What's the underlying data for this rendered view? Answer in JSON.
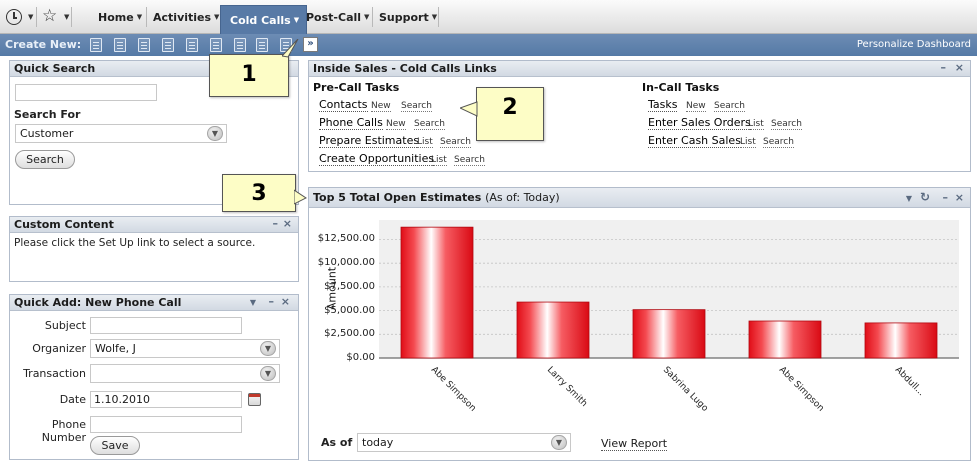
{
  "nav": {
    "items": [
      {
        "label": "Home"
      },
      {
        "label": "Activities"
      },
      {
        "label": "Cold Calls"
      },
      {
        "label": "Post-Call"
      },
      {
        "label": "Support"
      }
    ]
  },
  "createbar": {
    "label": "Create New:",
    "more": "»",
    "personalize": "Personalize Dashboard"
  },
  "quick_search": {
    "title": "Quick Search",
    "query_value": "",
    "search_for_label": "Search For",
    "search_for_value": "Customer",
    "search_button": "Search"
  },
  "custom_content": {
    "title": "Custom Content",
    "message": "Please click the Set Up link to select a source."
  },
  "quick_add": {
    "title": "Quick Add: New Phone Call",
    "subject_label": "Subject",
    "subject_value": "",
    "organizer_label": "Organizer",
    "organizer_value": "Wolfe, J",
    "transaction_label": "Transaction",
    "transaction_value": "",
    "date_label": "Date",
    "date_value": "1.10.2010",
    "phone_label": "Phone Number",
    "phone_value": "",
    "save_button": "Save"
  },
  "links_portlet": {
    "title": "Inside Sales - Cold Calls Links",
    "precall_heading": "Pre-Call Tasks",
    "precall": [
      {
        "label": "Contacts",
        "a": "New",
        "b": "Search"
      },
      {
        "label": "Phone Calls",
        "a": "New",
        "b": "Search"
      },
      {
        "label": "Prepare Estimates",
        "a": "List",
        "b": "Search"
      },
      {
        "label": "Create Opportunities",
        "a": "List",
        "b": "Search"
      }
    ],
    "incall_heading": "In-Call Tasks",
    "incall": [
      {
        "label": "Tasks",
        "a": "New",
        "b": "Search"
      },
      {
        "label": "Enter Sales Orders",
        "a": "List",
        "b": "Search"
      },
      {
        "label": "Enter Cash Sales",
        "a": "List",
        "b": "Search"
      }
    ]
  },
  "estimates_portlet": {
    "title": "Top 5 Total Open Estimates",
    "title_suffix": "(As of: Today)",
    "as_of_label": "As of",
    "as_of_value": "today",
    "view_report": "View Report"
  },
  "callouts": [
    "1",
    "2",
    "3"
  ],
  "colors": {
    "accent": "#557aa6",
    "bar": "#e8141c",
    "callout_bg": "#fdfdc6"
  },
  "chart_data": {
    "type": "bar",
    "title": "",
    "xlabel": "",
    "ylabel": "Amount",
    "categories": [
      "Abe Simpson",
      "Larry Smith",
      "Sabrina Lugo",
      "Abe Simpson",
      "Abdull..."
    ],
    "values": [
      13800,
      5900,
      5100,
      3900,
      3700
    ],
    "ylim": [
      0,
      13500
    ],
    "yticks": [
      "$0.00",
      "$2,500.00",
      "$5,000.00",
      "$7,500.00",
      "$10,000.00",
      "$12,500.00"
    ],
    "grid": true
  }
}
